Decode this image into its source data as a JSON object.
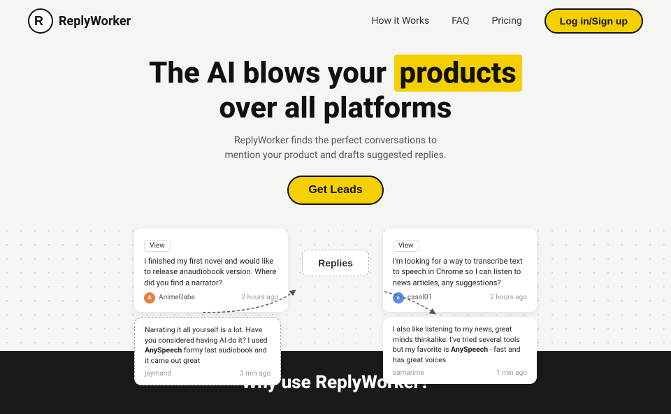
{
  "nav": {
    "logo_text": "ReplyWorker",
    "links": [
      {
        "label": "How it Works"
      },
      {
        "label": "FAQ"
      },
      {
        "label": "Pricing"
      }
    ],
    "login_label": "Log in/Sign up"
  },
  "hero": {
    "title_part1": "The AI blows your",
    "title_highlight": "products",
    "title_part2": "over all platforms",
    "subtitle": "ReplyWorker finds the perfect conversations to mention your product and drafts suggested replies.",
    "cta_label": "Get Leads"
  },
  "demo": {
    "replies_btn_label": "Replies",
    "left_top": {
      "view_btn": "View",
      "text": "I finished my first novel and would like to release anaudiobook version. Where did you find a narrator?",
      "user": "AnimeGabe",
      "time": "2 hours ago"
    },
    "left_reply": {
      "text": "Narrating it all yourself is a lot. Have you considered having AI do it? I used AnySpeech formy last audiobook and it came out great",
      "bold1": "AnySpeech",
      "user": "jaymand",
      "time": "3 min ago"
    },
    "right_top": {
      "view_btn": "View",
      "text": "I'm looking for a way to transcribe text to speech in Chrome so I can listen to news articles, any suggestions?",
      "user": "casol01",
      "time": "2 hours ago"
    },
    "right_reply": {
      "text": "I also like listening to my news, great minds thinkalike. I've tried several tools but my favorite is AnySpeech - fast and has great voices",
      "bold1": "AnySpeech",
      "user": "samarime",
      "time": "1 min ago"
    }
  },
  "why": {
    "title": "Why use ReplyWorker?"
  }
}
